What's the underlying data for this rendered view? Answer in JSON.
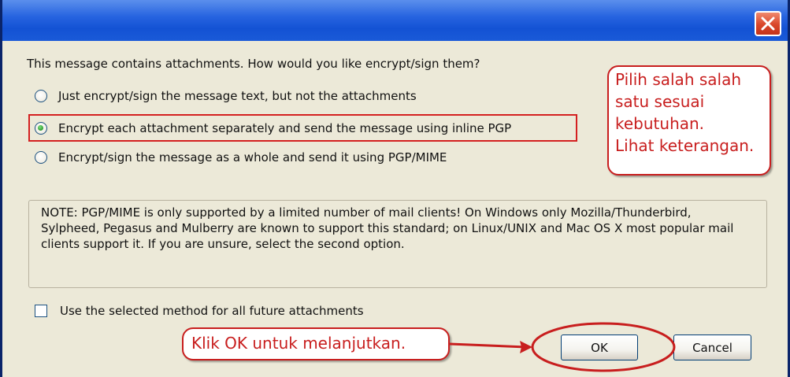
{
  "dialog": {
    "question": "This message contains attachments. How would you like encrypt/sign them?",
    "options": [
      {
        "label": "Just encrypt/sign the message text, but not the attachments",
        "selected": false
      },
      {
        "label": "Encrypt each attachment separately and send the message using inline PGP",
        "selected": true
      },
      {
        "label": "Encrypt/sign the message as a whole and send it using PGP/MIME",
        "selected": false
      }
    ],
    "note": "NOTE: PGP/MIME is only supported by a limited number of mail clients! On Windows only Mozilla/Thunderbird, Sylpheed, Pegasus and Mulberry are known to support this standard; on Linux/UNIX and Mac OS X most popular mail clients support it. If you are unsure, select the second option.",
    "checkbox_label": "Use the selected method for all future attachments",
    "checkbox_checked": false,
    "ok_label": "OK",
    "cancel_label": "Cancel"
  },
  "annotations": {
    "right_callout_lines": [
      "Pilih salah salah",
      "satu sesuai",
      "kebutuhan.",
      "Lihat keterangan."
    ],
    "bottom_callout": "Klik OK untuk melanjutkan."
  },
  "colors": {
    "titlebar": "#2764e0",
    "dialog_background": "#ece9d8",
    "annotation_red": "#c81e1e",
    "close_button": "#d9462a"
  },
  "icons": {
    "close": "close-x-icon"
  }
}
